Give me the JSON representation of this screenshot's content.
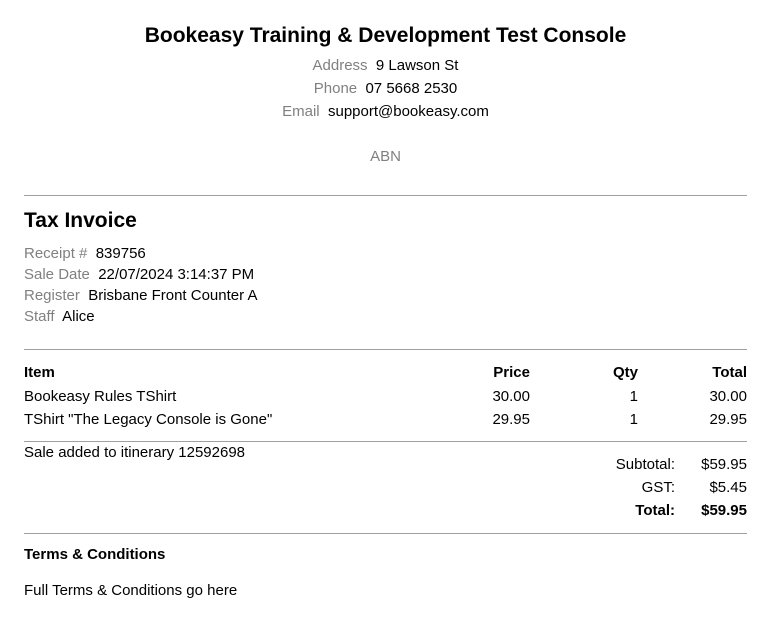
{
  "business": {
    "name": "Bookeasy Training & Development Test Console",
    "address_label": "Address",
    "address": "9 Lawson St",
    "phone_label": "Phone",
    "phone": "07 5668 2530",
    "email_label": "Email",
    "email": "support@bookeasy.com",
    "abn_label": "ABN"
  },
  "invoice": {
    "title": "Tax Invoice",
    "receipt_label": "Receipt #",
    "receipt": "839756",
    "sale_date_label": "Sale Date",
    "sale_date": "22/07/2024 3:14:37 PM",
    "register_label": "Register",
    "register": "Brisbane Front Counter A",
    "staff_label": "Staff",
    "staff": "Alice"
  },
  "items_table": {
    "headers": {
      "item": "Item",
      "price": "Price",
      "qty": "Qty",
      "total": "Total"
    },
    "rows": [
      {
        "item": "Bookeasy Rules TShirt",
        "price": "30.00",
        "qty": "1",
        "total": "30.00"
      },
      {
        "item": "TShirt \"The Legacy Console is Gone\"",
        "price": "29.95",
        "qty": "1",
        "total": "29.95"
      }
    ]
  },
  "note": "Sale added to itinerary 12592698",
  "totals": {
    "subtotal_label": "Subtotal:",
    "subtotal": "$59.95",
    "gst_label": "GST:",
    "gst": "$5.45",
    "total_label": "Total:",
    "total": "$59.95"
  },
  "terms": {
    "title": "Terms & Conditions",
    "text": "Full Terms & Conditions go here"
  }
}
